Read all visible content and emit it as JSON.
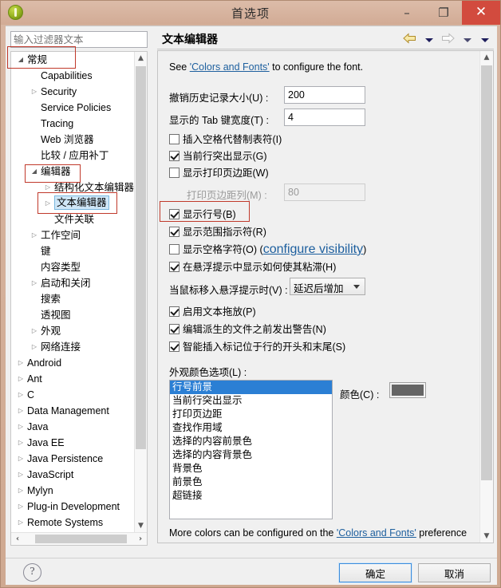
{
  "window": {
    "title": "首选项",
    "icon": "eclipse-icon",
    "buttons": {
      "minimize": "–",
      "maximize": "❐",
      "close": "✕"
    }
  },
  "sidebar": {
    "filter": {
      "placeholder": "输入过滤器文本",
      "value": ""
    },
    "tree": [
      {
        "label": "常规",
        "indent": 0,
        "arrow": "open",
        "selected": false
      },
      {
        "label": "Capabilities",
        "indent": 1,
        "arrow": "none",
        "selected": false
      },
      {
        "label": "Security",
        "indent": 1,
        "arrow": "closed",
        "selected": false
      },
      {
        "label": "Service Policies",
        "indent": 1,
        "arrow": "none",
        "selected": false
      },
      {
        "label": "Tracing",
        "indent": 1,
        "arrow": "none",
        "selected": false
      },
      {
        "label": "Web 浏览器",
        "indent": 1,
        "arrow": "none",
        "selected": false
      },
      {
        "label": "比较 / 应用补丁",
        "indent": 1,
        "arrow": "none",
        "selected": false
      },
      {
        "label": "编辑器",
        "indent": 1,
        "arrow": "open",
        "selected": false
      },
      {
        "label": "结构化文本编辑器",
        "indent": 2,
        "arrow": "closed",
        "selected": false
      },
      {
        "label": "文本编辑器",
        "indent": 2,
        "arrow": "closed",
        "selected": true
      },
      {
        "label": "文件关联",
        "indent": 2,
        "arrow": "none",
        "selected": false
      },
      {
        "label": "工作空间",
        "indent": 1,
        "arrow": "closed",
        "selected": false
      },
      {
        "label": "键",
        "indent": 1,
        "arrow": "none",
        "selected": false
      },
      {
        "label": "内容类型",
        "indent": 1,
        "arrow": "none",
        "selected": false
      },
      {
        "label": "启动和关闭",
        "indent": 1,
        "arrow": "closed",
        "selected": false
      },
      {
        "label": "搜索",
        "indent": 1,
        "arrow": "none",
        "selected": false
      },
      {
        "label": "透视图",
        "indent": 1,
        "arrow": "none",
        "selected": false
      },
      {
        "label": "外观",
        "indent": 1,
        "arrow": "closed",
        "selected": false
      },
      {
        "label": "网络连接",
        "indent": 1,
        "arrow": "closed",
        "selected": false
      },
      {
        "label": "Android",
        "indent": 0,
        "arrow": "closed",
        "selected": false
      },
      {
        "label": "Ant",
        "indent": 0,
        "arrow": "closed",
        "selected": false
      },
      {
        "label": "C",
        "indent": 0,
        "arrow": "closed",
        "selected": false
      },
      {
        "label": "Data Management",
        "indent": 0,
        "arrow": "closed",
        "selected": false
      },
      {
        "label": "Java",
        "indent": 0,
        "arrow": "closed",
        "selected": false
      },
      {
        "label": "Java EE",
        "indent": 0,
        "arrow": "closed",
        "selected": false
      },
      {
        "label": "Java Persistence",
        "indent": 0,
        "arrow": "closed",
        "selected": false
      },
      {
        "label": "JavaScript",
        "indent": 0,
        "arrow": "closed",
        "selected": false
      },
      {
        "label": "Mylyn",
        "indent": 0,
        "arrow": "closed",
        "selected": false
      },
      {
        "label": "Plug-in Development",
        "indent": 0,
        "arrow": "closed",
        "selected": false
      },
      {
        "label": "Remote Systems",
        "indent": 0,
        "arrow": "closed",
        "selected": false
      }
    ]
  },
  "page": {
    "title": "文本编辑器",
    "intro_prefix": "See ",
    "intro_link": "'Colors and Fonts'",
    "intro_suffix": " to configure the font.",
    "fields": [
      {
        "label": "撤销历史记录大小(U) :",
        "value": "200",
        "disabled": false
      },
      {
        "label": "显示的 Tab 键宽度(T) :",
        "value": "4",
        "disabled": false
      },
      {
        "label": "打印页边距列(M) :",
        "value": "80",
        "disabled": true
      }
    ],
    "checkboxes": [
      {
        "label": "插入空格代替制表符(I)",
        "checked": false
      },
      {
        "label": "当前行突出显示(G)",
        "checked": true
      },
      {
        "label": "显示打印页边距(W)",
        "checked": false
      },
      {
        "label": "显示行号(B)",
        "checked": true
      },
      {
        "label": "显示范围指示符(R)",
        "checked": true
      },
      {
        "label": "显示空格字符(O)",
        "checked": false,
        "link": "configure visibility"
      },
      {
        "label": "在悬浮提示中显示如何使其粘滞(H)",
        "checked": true
      },
      {
        "label": "启用文本拖放(P)",
        "checked": true
      },
      {
        "label": "编辑派生的文件之前发出警告(N)",
        "checked": true
      },
      {
        "label": "智能插入标记位于行的开头和末尾(S)",
        "checked": true
      }
    ],
    "hover_label": "当鼠标移入悬浮提示时(V) :",
    "hover_value": "延迟后增加",
    "appearance_label": "外观颜色选项(L) :",
    "color_list": [
      "行号前景",
      "当前行突出显示",
      "打印页边距",
      "查找作用域",
      "选择的内容前景色",
      "选择的内容背景色",
      "背景色",
      "前景色",
      "超链接"
    ],
    "color_list_selected": 0,
    "color_label": "颜色(C) :",
    "color_value": "#656565",
    "footer_prefix": "More colors can be configured on the ",
    "footer_link": "'Colors and Fonts'",
    "footer_suffix": " preference"
  },
  "buttons": {
    "ok": "确定",
    "cancel": "取消",
    "help": "?"
  },
  "colors": {
    "accent": "#2b7fd4",
    "close_button": "#d24b3e",
    "annotation": "#c0392b",
    "frame": "#d2ab95"
  }
}
